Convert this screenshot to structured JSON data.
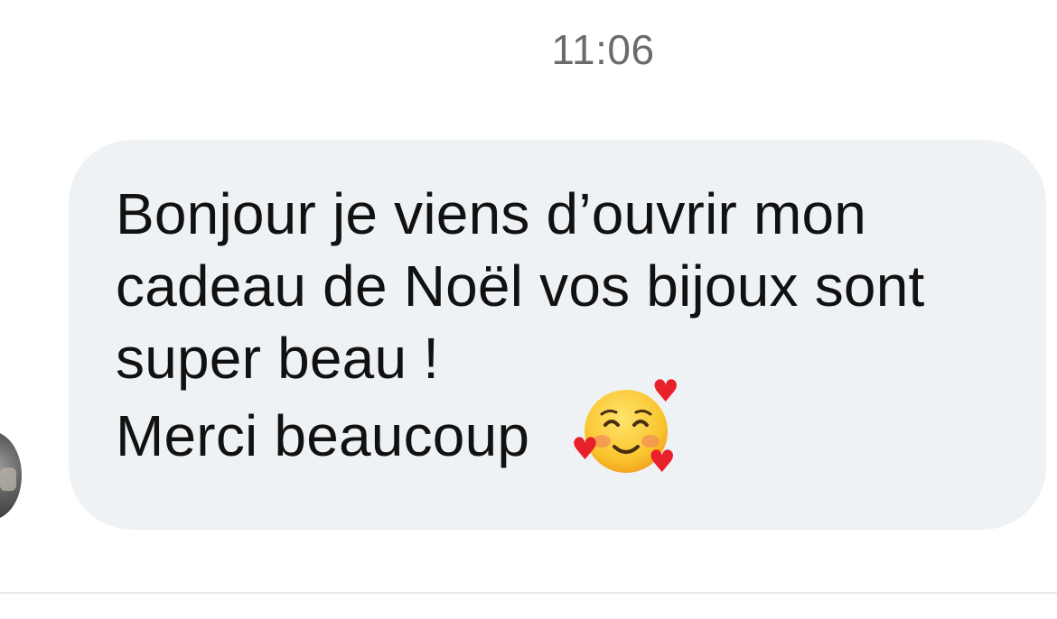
{
  "conversation": {
    "timestamp": "11:06",
    "message": {
      "lines": [
        "Bonjour je viens d’ouvrir mon",
        "cadeau de Noël vos bijoux sont",
        "super beau !",
        "Merci beaucoup"
      ],
      "emoji": "smiling-face-with-hearts-icon"
    }
  },
  "colors": {
    "bubble_background": "#eff2f5",
    "message_text": "#111111",
    "timestamp_text": "#6b6b6b"
  }
}
